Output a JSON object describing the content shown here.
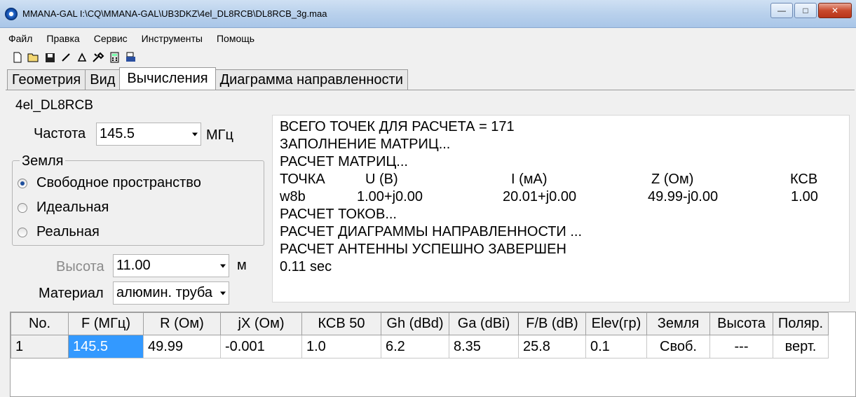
{
  "window": {
    "title": "MMANA-GAL I:\\CQ\\MMANA-GAL\\UB3DKZ\\4el_DL8RCB\\DL8RCB_3g.maa",
    "buttons": {
      "minimize": "—",
      "maximize": "□",
      "close": "✕"
    }
  },
  "menu": [
    "Файл",
    "Правка",
    "Сервис",
    "Инструменты",
    "Помощь"
  ],
  "toolbar": [
    "new-file-icon",
    "open-folder-icon",
    "save-icon",
    "line-icon",
    "triangle-icon",
    "tools-icon",
    "calculator-icon",
    "print-icon"
  ],
  "tabs": [
    {
      "label": "Геометрия",
      "active": false
    },
    {
      "label": "Вид",
      "active": false
    },
    {
      "label": "Вычисления",
      "active": true
    },
    {
      "label": "Диаграмма направленности",
      "active": false
    }
  ],
  "calc": {
    "antenna_name": "4el_DL8RCB",
    "freq_label": "Частота",
    "freq_value": "145.5",
    "freq_unit": "МГц",
    "ground_title": "Земля",
    "ground_options": [
      {
        "label": "Свободное пространство",
        "checked": true
      },
      {
        "label": "Идеальная",
        "checked": false
      },
      {
        "label": "Реальная",
        "checked": false
      }
    ],
    "height_label": "Высота",
    "height_value": "11.00",
    "height_unit": "м",
    "material_label": "Материал",
    "material_value": "алюмин. труба"
  },
  "output": {
    "line1": "ВСЕГО ТОЧЕК ДЛЯ РАСЧЕТА = 171",
    "line2": "ЗАПОЛНЕНИЕ МАТРИЦ...",
    "line3": "РАСЧЕТ МАТРИЦ...",
    "header": [
      "ТОЧКА",
      "U (В)",
      "I (мА)",
      "Z (Ом)",
      "КСВ"
    ],
    "row": [
      "w8b",
      "1.00+j0.00",
      "20.01+j0.00",
      "49.99-j0.00",
      "1.00"
    ],
    "line6": "РАСЧЕТ ТОКОВ...",
    "line7": "РАСЧЕТ ДИАГРАММЫ НАПРАВЛЕННОСТИ ...",
    "line8": "РАСЧЕТ АНТЕННЫ УСПЕШНО ЗАВЕРШЕН",
    "line9": "0.11 sec"
  },
  "results": {
    "columns": [
      "No.",
      "F (МГц)",
      "R (Ом)",
      "jX (Ом)",
      "КСВ 50",
      "Gh (dBd)",
      "Ga (dBi)",
      "F/B (dB)",
      "Elev(гр)",
      "Земля",
      "Высота",
      "Поляр."
    ],
    "rows": [
      [
        "1",
        "145.5",
        "49.99",
        "-0.001",
        "1.0",
        "6.2",
        "8.35",
        "25.8",
        "0.1",
        "Своб.",
        "---",
        "верт."
      ]
    ]
  }
}
